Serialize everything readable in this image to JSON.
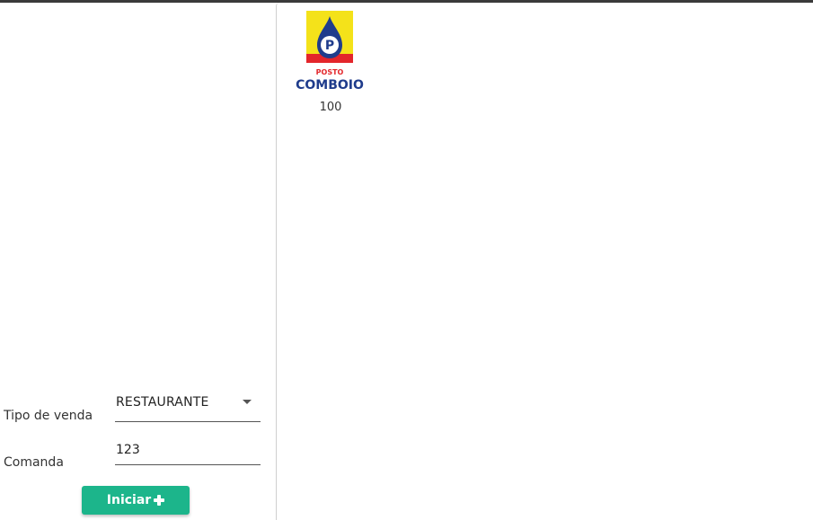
{
  "store": {
    "logo_text_top": "POSTO",
    "logo_text_bottom": "COMBOIO",
    "logo_letter": "P",
    "number": "100"
  },
  "form": {
    "sale_type_label": "Tipo de venda",
    "sale_type_value": "RESTAURANTE",
    "order_label": "Comanda",
    "order_value": "123",
    "start_button_label": "Iniciar"
  },
  "colors": {
    "button": "#1cb58b",
    "logo_yellow": "#f4e21a",
    "logo_red": "#e3262b",
    "logo_blue": "#1f3c8c"
  }
}
